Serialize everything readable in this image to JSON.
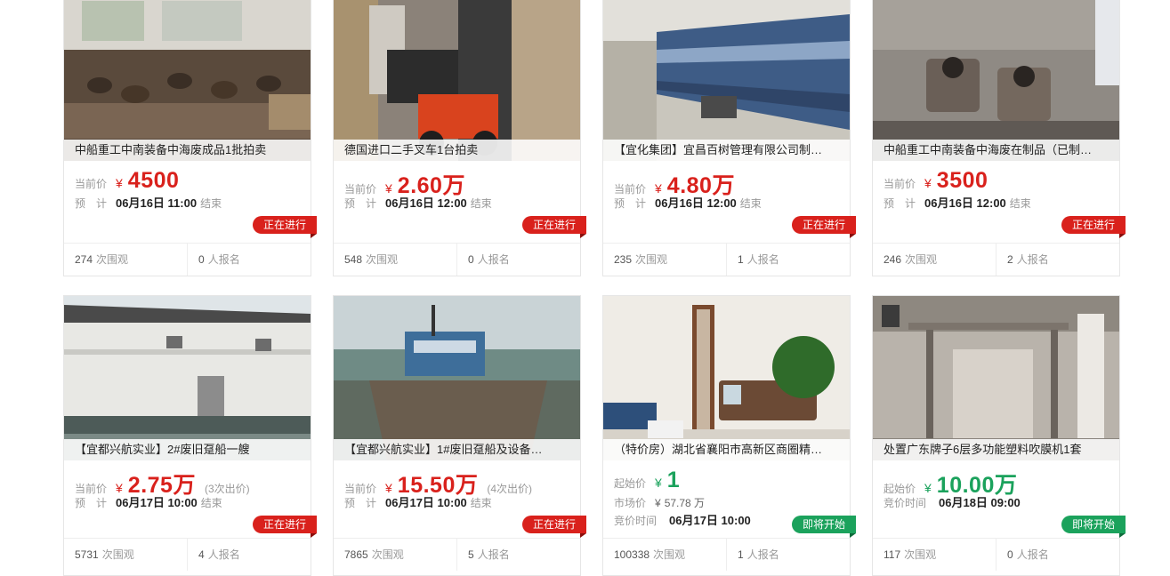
{
  "currency_symbol": "¥",
  "labels": {
    "current_price": "当前价",
    "estimate": "预　计",
    "start_price": "起始价",
    "market_price": "市场价",
    "bid_time": "竞价时间",
    "ends": "结束",
    "views": "次围观",
    "signups": "人报名"
  },
  "cards": [
    {
      "title": "中船重工中南装备中海废成品1批拍卖",
      "price": "4500",
      "price_color": "#d9211c",
      "time": "06月16日 11:00",
      "status": "正在进行",
      "views": "274",
      "signups": "0"
    },
    {
      "title": "德国进口二手叉车1台拍卖",
      "price": "2.60万",
      "price_color": "#d9211c",
      "time": "06月16日 12:00",
      "status": "正在进行",
      "views": "548",
      "signups": "0"
    },
    {
      "title": "【宜化集团】宜昌百树管理有限公司制…",
      "price": "4.80万",
      "price_color": "#d9211c",
      "time": "06月16日 12:00",
      "status": "正在进行",
      "views": "235",
      "signups": "1"
    },
    {
      "title": "中船重工中南装备中海废在制品（已制…",
      "price": "3500",
      "price_color": "#d9211c",
      "time": "06月16日 12:00",
      "status": "正在进行",
      "views": "246",
      "signups": "2"
    },
    {
      "title": "【宜都兴航实业】2#废旧趸船一艘",
      "price": "2.75万",
      "price_color": "#d9211c",
      "bids": "(3次出价)",
      "time": "06月17日 10:00",
      "status": "正在进行",
      "views": "5731",
      "signups": "4"
    },
    {
      "title": "【宜都兴航实业】1#废旧趸船及设备…",
      "price": "15.50万",
      "price_color": "#d9211c",
      "bids": "(4次出价)",
      "time": "06月17日 10:00",
      "status": "正在进行",
      "views": "7865",
      "signups": "5"
    },
    {
      "title": "（特价房）湖北省襄阳市高新区商圈精…",
      "price": "1",
      "price_color": "#1ba25c",
      "market_price": "57.78 万",
      "time": "06月17日 10:00",
      "status": "即将开始",
      "views": "100338",
      "signups": "1"
    },
    {
      "title": "处置广东牌子6层多功能塑料吹膜机1套",
      "price": "10.00万",
      "price_color": "#1ba25c",
      "time": "06月18日 09:00",
      "status": "即将开始",
      "views": "117",
      "signups": "0"
    }
  ]
}
